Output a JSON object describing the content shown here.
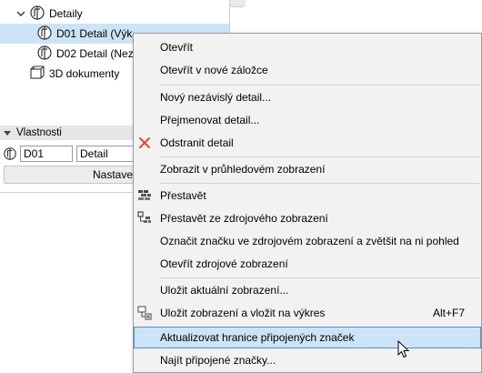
{
  "navigator": {
    "tree": {
      "details_label": "Detaily",
      "d01_label": "D01 Detail (Výk",
      "d02_label": "D02 Detail (Nez",
      "docs3d_label": "3D dokumenty"
    },
    "properties": {
      "header": "Vlastnosti",
      "id_value": "D01",
      "name_value": "Detail",
      "settings_button": "Nastave"
    }
  },
  "context_menu": {
    "items": [
      {
        "label": "Otevřít"
      },
      {
        "label": "Otevřít v nové záložce"
      },
      {
        "label": "Nový nezávislý detail..."
      },
      {
        "label": "Přejmenovat detail..."
      },
      {
        "label": "Odstranit detail",
        "icon": "delete-x-icon"
      },
      {
        "label": "Zobrazit v průhledovém zobrazení"
      },
      {
        "label": "Přestavět",
        "icon": "rebuild-icon"
      },
      {
        "label": "Přestavět ze zdrojového zobrazení",
        "icon": "rebuild-from-source-icon"
      },
      {
        "label": "Označit značku ve zdrojovém zobrazení a zvětšit na ni pohled"
      },
      {
        "label": "Otevřít zdrojové zobrazení"
      },
      {
        "label": "Uložit aktuální zobrazení..."
      },
      {
        "label": "Uložit zobrazení a vložit na výkres",
        "shortcut": "Alt+F7",
        "icon": "save-place-icon"
      },
      {
        "label": "Aktualizovat hranice připojených značek",
        "highlighted": true
      },
      {
        "label": "Najít připojené značky..."
      }
    ]
  },
  "colors": {
    "highlight": "#cce4f7",
    "highlight_border": "#4f8fcc",
    "delete_icon": "#e0483a",
    "menu_bg": "#f2f2f2"
  }
}
